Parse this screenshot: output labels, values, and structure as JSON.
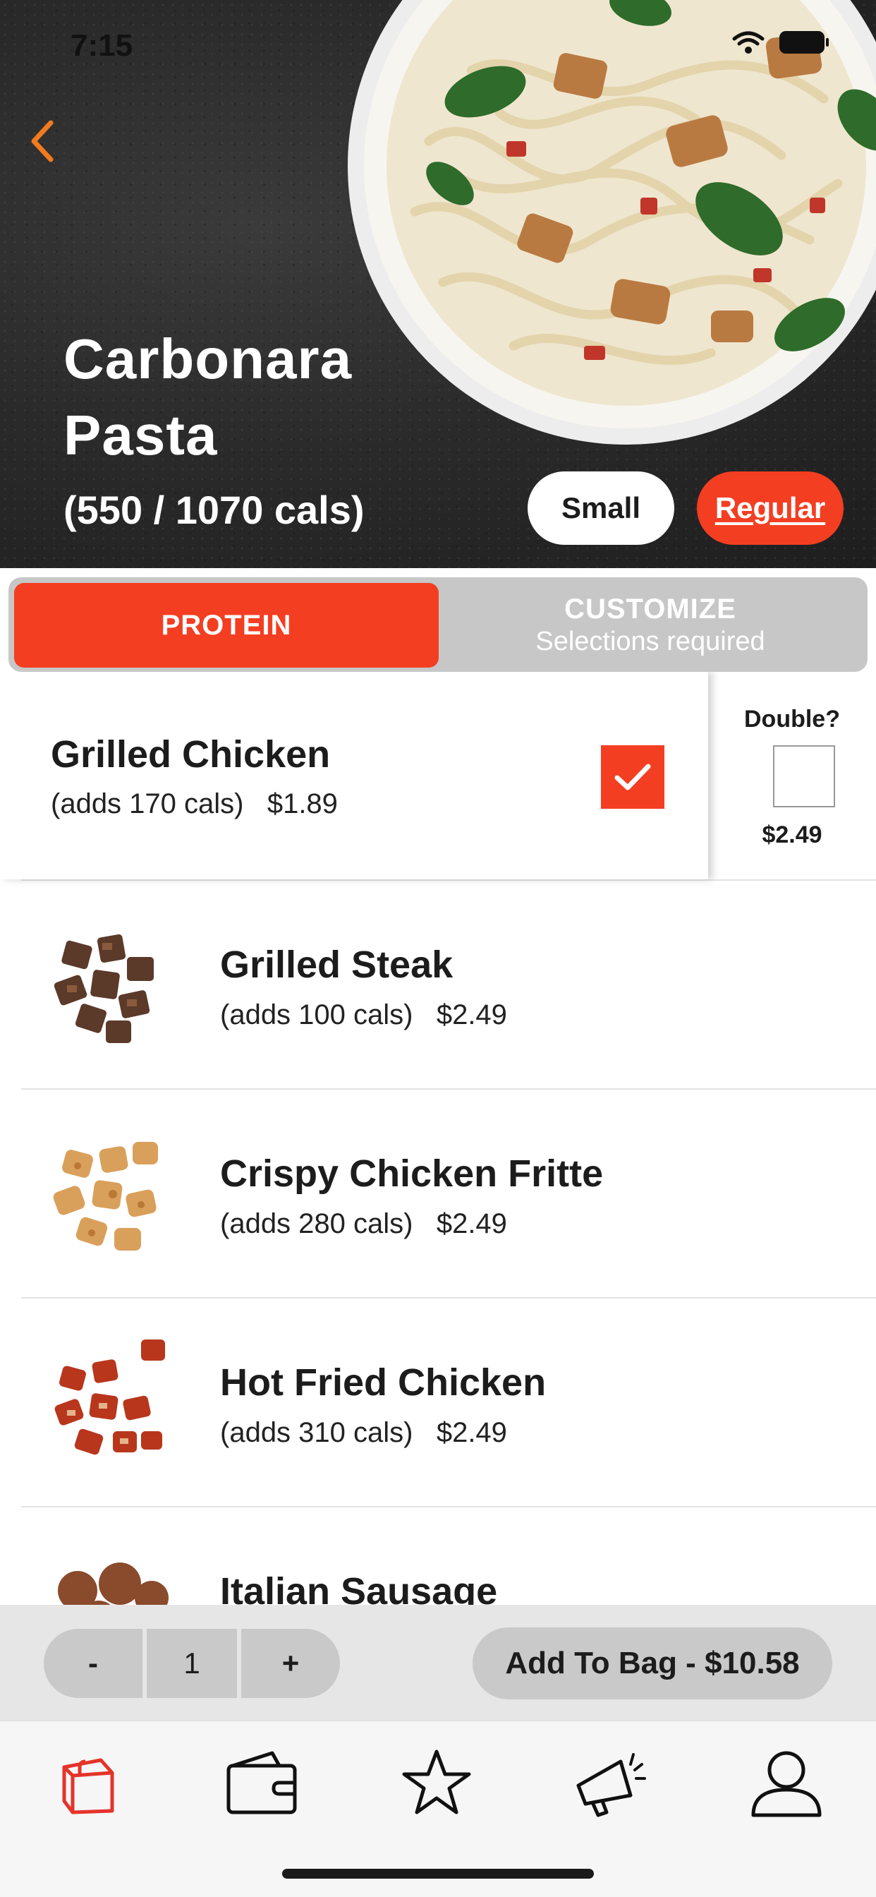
{
  "status_bar": {
    "time": "7:15"
  },
  "hero": {
    "title": "Carbonara Pasta",
    "calories": "(550 / 1070 cals)",
    "sizes": {
      "small": "Small",
      "regular": "Regular",
      "selected": "Regular"
    }
  },
  "tabs": {
    "protein": "PROTEIN",
    "customize": "CUSTOMIZE",
    "customize_sub": "Selections required"
  },
  "selected_option": {
    "name": "Grilled Chicken",
    "cals": "(adds 170 cals)",
    "price": "$1.89",
    "checked": true,
    "double_label": "Double?",
    "double_price": "$2.49",
    "double_checked": false
  },
  "options": [
    {
      "name": "Grilled Steak",
      "cals": "(adds 100 cals)",
      "price": "$2.49",
      "image": "steak-icon"
    },
    {
      "name": "Crispy Chicken Fritte",
      "cals": "(adds 280 cals)",
      "price": "$2.49",
      "image": "crispy-chicken-icon"
    },
    {
      "name": "Hot Fried Chicken",
      "cals": "(adds 310 cals)",
      "price": "$2.49",
      "image": "hot-chicken-icon"
    },
    {
      "name": "Italian Sausage",
      "image": "sausage-icon"
    }
  ],
  "action_bar": {
    "minus": "-",
    "quantity": "1",
    "plus": "+",
    "add_to_bag": "Add To Bag - $10.58"
  },
  "tab_bar": {
    "items": [
      "bag-icon",
      "wallet-icon",
      "star-icon",
      "megaphone-icon",
      "profile-icon"
    ],
    "active": "bag-icon"
  },
  "colors": {
    "accent": "#f43e22",
    "grey": "#c9c9c9",
    "hero_bg": "#2b2b2b"
  }
}
